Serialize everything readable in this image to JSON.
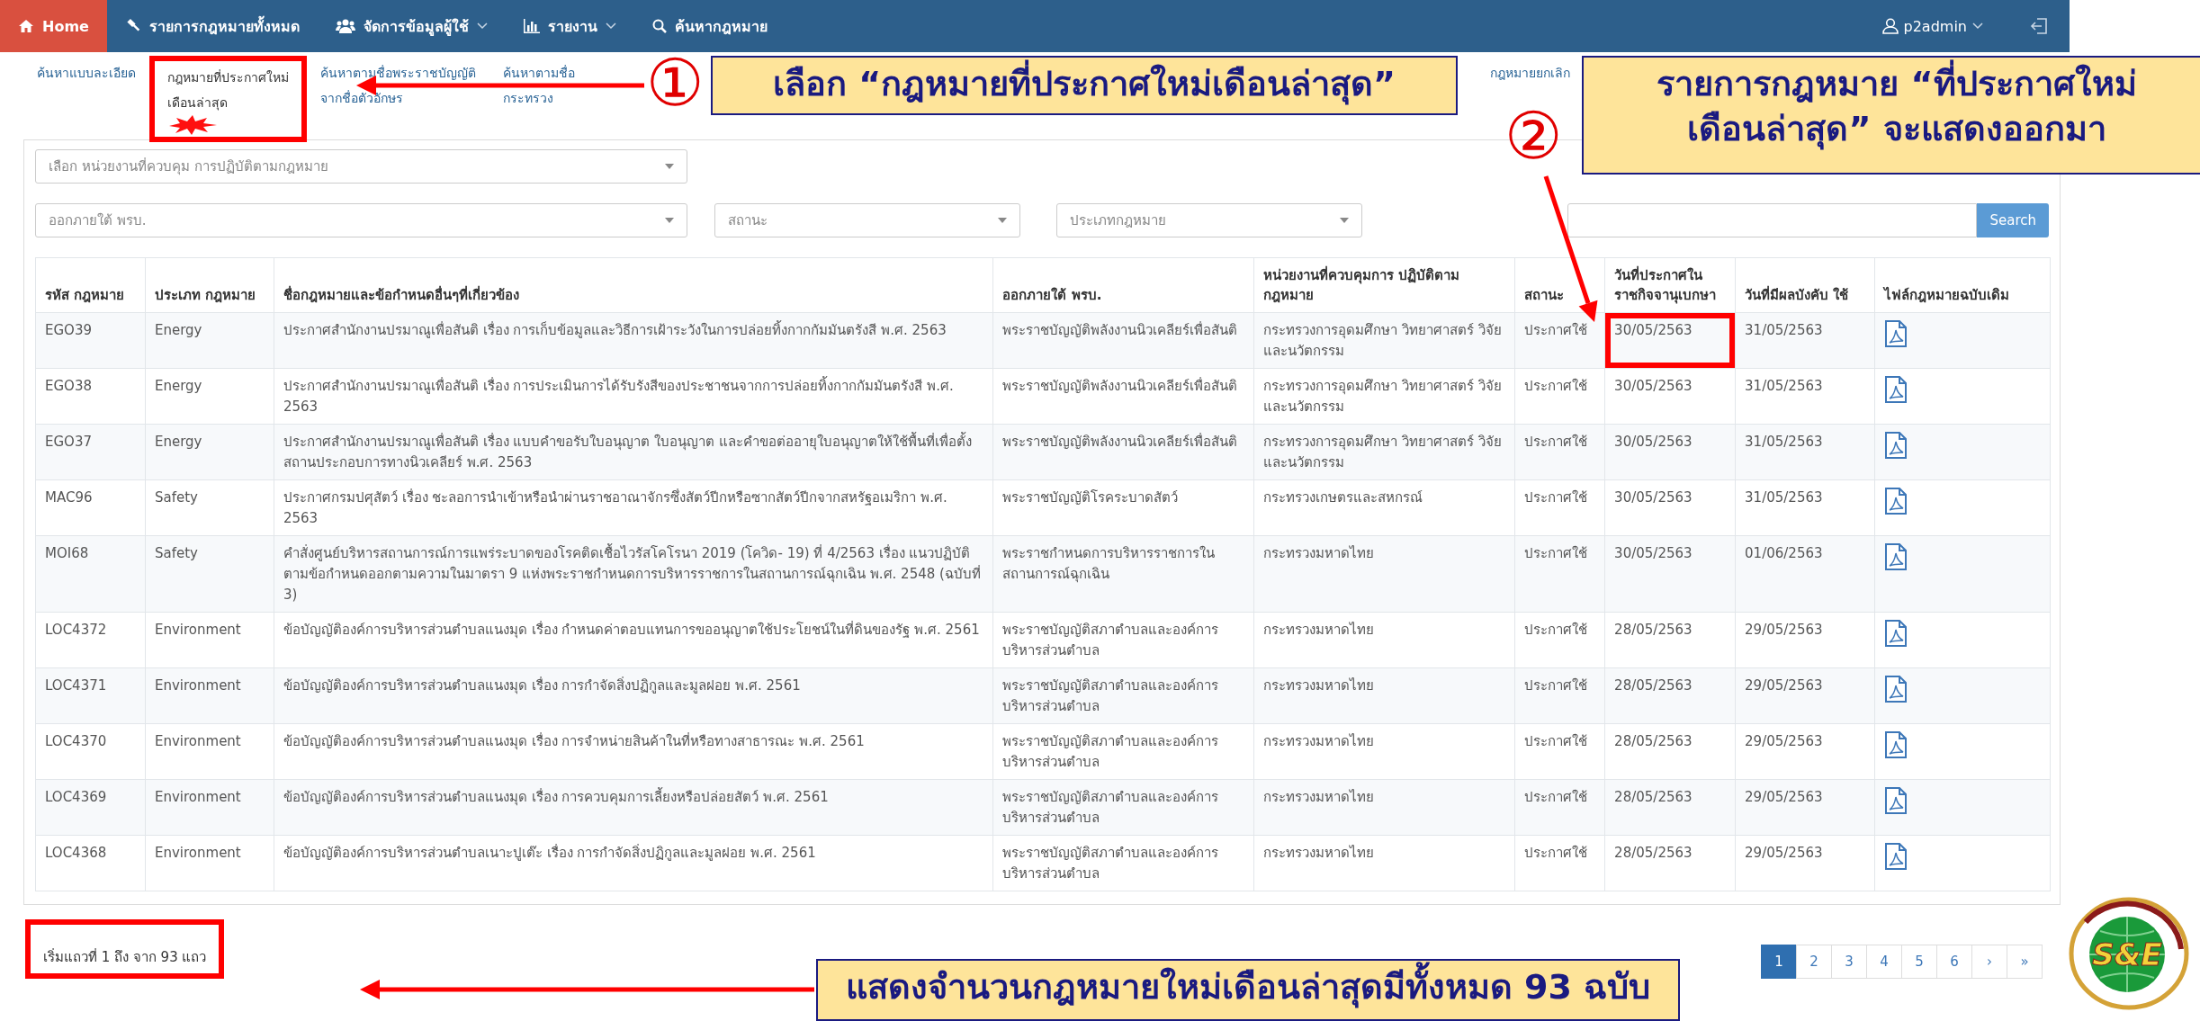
{
  "navbar": {
    "items": [
      {
        "label": "Home",
        "selected": true,
        "has_menu": false
      },
      {
        "label": "รายการกฎหมายทั้งหมด",
        "selected": false,
        "has_menu": false
      },
      {
        "label": "จัดการข้อมูลผู้ใช้",
        "selected": false,
        "has_menu": true
      },
      {
        "label": "รายงาน",
        "selected": false,
        "has_menu": true
      },
      {
        "label": "ค้นหากฎหมาย",
        "selected": false,
        "has_menu": false
      }
    ],
    "user": "p2admin"
  },
  "tabs": [
    {
      "label": "ค้นหาแบบละเอียด",
      "selected": false,
      "new_badge": false,
      "highlighted": false
    },
    {
      "label": "กฎหมายที่ประกาศใหม่ เดือนล่าสุด",
      "selected": true,
      "new_badge": true,
      "highlighted": true
    },
    {
      "label": "ค้นหาตามชื่อพระราชบัญญัติ จากชื่อตัวอักษร",
      "selected": false,
      "new_badge": false,
      "highlighted": false
    },
    {
      "label": "ค้นหาตามชื่อ กระทรวง",
      "selected": false,
      "new_badge": false,
      "highlighted": false
    },
    {
      "label": "กฎหมายยกเลิก",
      "selected": false,
      "new_badge": false,
      "highlighted": false
    }
  ],
  "filters": {
    "agency": {
      "placeholder": "เลือก หน่วยงานที่ควบคุม การปฏิบัติตามกฎหมาย"
    },
    "act": {
      "placeholder": "ออกภายใต้ พรบ."
    },
    "status": {
      "placeholder": "สถานะ"
    },
    "law_type": {
      "placeholder": "ประเภทกฎหมาย"
    },
    "search_button": "Search"
  },
  "table": {
    "columns": [
      "รหัส กฎหมาย",
      "ประเภท กฎหมาย",
      "ชื่อกฎหมายและข้อกำหนดอื่นๆที่เกี่ยวข้อง",
      "ออกภายใต้ พรบ.",
      "หน่วยงานที่ควบคุมการ ปฏิบัติตามกฎหมาย",
      "สถานะ",
      "วันที่ประกาศใน ราชกิจจานุเบกษา",
      "วันที่มีผลบังคับ ใช้",
      "ไฟล์กฎหมายฉบับเดิม"
    ],
    "rows": [
      {
        "code": "EGO39",
        "type": "Energy",
        "name": "ประกาศสำนักงานปรมาณูเพื่อสันติ เรื่อง การเก็บข้อมูลและวิธีการเฝ้าระวังในการปล่อยทิ้งกากกัมมันตรังสี พ.ศ. 2563",
        "act": "พระราชบัญญัติพลังงานนิวเคลียร์เพื่อสันติ",
        "agency": "กระทรวงการอุดมศึกษา วิทยาศาสตร์ วิจัยและนวัตกรรม",
        "status": "ประกาศใช้",
        "published": "30/05/2563",
        "effective": "31/05/2563",
        "published_highlighted": true
      },
      {
        "code": "EGO38",
        "type": "Energy",
        "name": "ประกาศสำนักงานปรมาณูเพื่อสันติ เรื่อง การประเมินการได้รับรังสีของประชาชนจากการปล่อยทิ้งกากกัมมันตรังสี พ.ศ. 2563",
        "act": "พระราชบัญญัติพลังงานนิวเคลียร์เพื่อสันติ",
        "agency": "กระทรวงการอุดมศึกษา วิทยาศาสตร์ วิจัยและนวัตกรรม",
        "status": "ประกาศใช้",
        "published": "30/05/2563",
        "effective": "31/05/2563",
        "published_highlighted": false
      },
      {
        "code": "EGO37",
        "type": "Energy",
        "name": "ประกาศสำนักงานปรมาณูเพื่อสันติ เรื่อง แบบคำขอรับใบอนุญาต ใบอนุญาต และคำขอต่ออายุใบอนุญาตให้ใช้พื้นที่เพื่อตั้งสถานประกอบการทางนิวเคลียร์ พ.ศ. 2563",
        "act": "พระราชบัญญัติพลังงานนิวเคลียร์เพื่อสันติ",
        "agency": "กระทรวงการอุดมศึกษา วิทยาศาสตร์ วิจัยและนวัตกรรม",
        "status": "ประกาศใช้",
        "published": "30/05/2563",
        "effective": "31/05/2563",
        "published_highlighted": false
      },
      {
        "code": "MAC96",
        "type": "Safety",
        "name": "ประกาศกรมปศุสัตว์ เรื่อง ชะลอการนำเข้าหรือนำผ่านราชอาณาจักรซึ่งสัตว์ปีกหรือซากสัตว์ปีกจากสหรัฐอเมริกา พ.ศ. 2563",
        "act": "พระราชบัญญัติโรคระบาดสัตว์",
        "agency": "กระทรวงเกษตรและสหกรณ์",
        "status": "ประกาศใช้",
        "published": "30/05/2563",
        "effective": "31/05/2563",
        "published_highlighted": false
      },
      {
        "code": "MOI68",
        "type": "Safety",
        "name": "คำสั่งศูนย์บริหารสถานการณ์การแพร่ระบาดของโรคติดเชื้อไวรัสโคโรนา 2019 (โควิด- 19) ที่ 4/2563 เรื่อง แนวปฏิบัติตามข้อกำหนดออกตามความในมาตรา 9 แห่งพระราชกำหนดการบริหารราชการในสถานการณ์ฉุกเฉิน พ.ศ. 2548 (ฉบับที่ 3)",
        "act": "พระราชกำหนดการบริหารราชการในสถานการณ์ฉุกเฉิน",
        "agency": "กระทรวงมหาดไทย",
        "status": "ประกาศใช้",
        "published": "30/05/2563",
        "effective": "01/06/2563",
        "published_highlighted": false
      },
      {
        "code": "LOC4372",
        "type": "Environment",
        "name": "ข้อบัญญัติองค์การบริหารส่วนตำบลแนงมุด เรื่อง กำหนดค่าตอบแทนการขออนุญาตใช้ประโยชน์ในที่ดินของรัฐ พ.ศ. 2561",
        "act": "พระราชบัญญัติสภาตำบลและองค์การบริหารส่วนตำบล",
        "agency": "กระทรวงมหาดไทย",
        "status": "ประกาศใช้",
        "published": "28/05/2563",
        "effective": "29/05/2563",
        "published_highlighted": false
      },
      {
        "code": "LOC4371",
        "type": "Environment",
        "name": "ข้อบัญญัติองค์การบริหารส่วนตำบลแนงมุด เรื่อง การกำจัดสิ่งปฏิกูลและมูลฝอย พ.ศ. 2561",
        "act": "พระราชบัญญัติสภาตำบลและองค์การบริหารส่วนตำบล",
        "agency": "กระทรวงมหาดไทย",
        "status": "ประกาศใช้",
        "published": "28/05/2563",
        "effective": "29/05/2563",
        "published_highlighted": false
      },
      {
        "code": "LOC4370",
        "type": "Environment",
        "name": "ข้อบัญญัติองค์การบริหารส่วนตำบลแนงมุด เรื่อง การจำหน่ายสินค้าในที่หรือทางสาธารณะ พ.ศ. 2561",
        "act": "พระราชบัญญัติสภาตำบลและองค์การบริหารส่วนตำบล",
        "agency": "กระทรวงมหาดไทย",
        "status": "ประกาศใช้",
        "published": "28/05/2563",
        "effective": "29/05/2563",
        "published_highlighted": false
      },
      {
        "code": "LOC4369",
        "type": "Environment",
        "name": "ข้อบัญญัติองค์การบริหารส่วนตำบลแนงมุด เรื่อง การควบคุมการเลี้ยงหรือปล่อยสัตว์ พ.ศ. 2561",
        "act": "พระราชบัญญัติสภาตำบลและองค์การบริหารส่วนตำบล",
        "agency": "กระทรวงมหาดไทย",
        "status": "ประกาศใช้",
        "published": "28/05/2563",
        "effective": "29/05/2563",
        "published_highlighted": false
      },
      {
        "code": "LOC4368",
        "type": "Environment",
        "name": "ข้อบัญญัติองค์การบริหารส่วนตำบลเนาะปูเต๊ะ เรื่อง การกำจัดสิ่งปฏิกูลและมูลฝอย พ.ศ. 2561",
        "act": "พระราชบัญญัติสภาตำบลและองค์การบริหารส่วนตำบล",
        "agency": "กระทรวงมหาดไทย",
        "status": "ประกาศใช้",
        "published": "28/05/2563",
        "effective": "29/05/2563",
        "published_highlighted": false
      }
    ]
  },
  "footer": {
    "info": "เริ่มแถวที่ 1 ถึง จาก 93 แถว",
    "info_highlighted": true,
    "pages": [
      {
        "label": "1",
        "selected": true
      },
      {
        "label": "2",
        "selected": false
      },
      {
        "label": "3",
        "selected": false
      },
      {
        "label": "4",
        "selected": false
      },
      {
        "label": "5",
        "selected": false
      },
      {
        "label": "6",
        "selected": false
      },
      {
        "label": "›",
        "selected": false
      },
      {
        "label": "»",
        "selected": false
      }
    ]
  },
  "annotations": [
    {
      "number": "①",
      "text": "เลือก “กฎหมายที่ประกาศใหม่เดือนล่าสุด”"
    },
    {
      "number": "②",
      "text": "รายการกฎหมาย “ที่ประกาศใหม่\nเดือนล่าสุด” จะแสดงออกมา"
    },
    {
      "text": "แสดงจำนวนกฎหมายใหม่เดือนล่าสุดมีทั้งหมด 93 ฉบับ"
    }
  ],
  "logo": {
    "text": "S&E"
  }
}
